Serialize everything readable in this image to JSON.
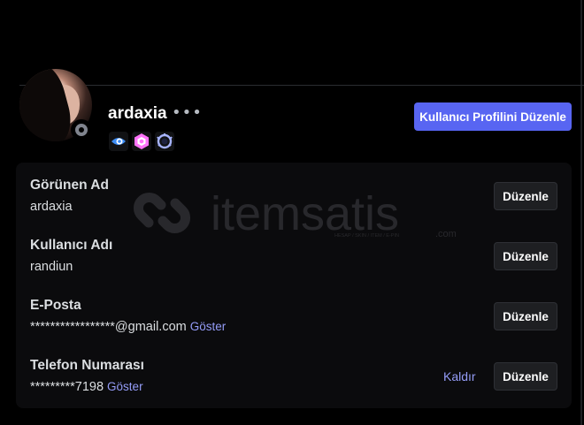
{
  "colors": {
    "background": "#000000",
    "card": "#0b0b0d",
    "accent": "#5865f2",
    "link": "#949cf7",
    "status_offline": "#80848e"
  },
  "profile": {
    "username": "ardaxia",
    "more_glyph": "•••",
    "status": "offline",
    "edit_profile_label": "Kullanıcı Profilini Düzenle",
    "badges": [
      "hypesquad-badge-icon",
      "nitro-boost-badge-icon",
      "quest-badge-icon"
    ]
  },
  "watermark": {
    "brand": "itemsatis",
    "tagline": "HESAP / SKIN / ITEM / E-PIN",
    "suffix": ".com"
  },
  "fields": [
    {
      "label": "Görünen Ad",
      "value": "ardaxia",
      "edit_label": "Düzenle"
    },
    {
      "label": "Kullanıcı Adı",
      "value": "randiun",
      "edit_label": "Düzenle"
    },
    {
      "label": "E-Posta",
      "value": "*****************@gmail.com",
      "reveal_label": "Göster",
      "edit_label": "Düzenle"
    },
    {
      "label": "Telefon Numarası",
      "value": "*********7198",
      "reveal_label": "Göster",
      "remove_label": "Kaldır",
      "edit_label": "Düzenle"
    }
  ]
}
